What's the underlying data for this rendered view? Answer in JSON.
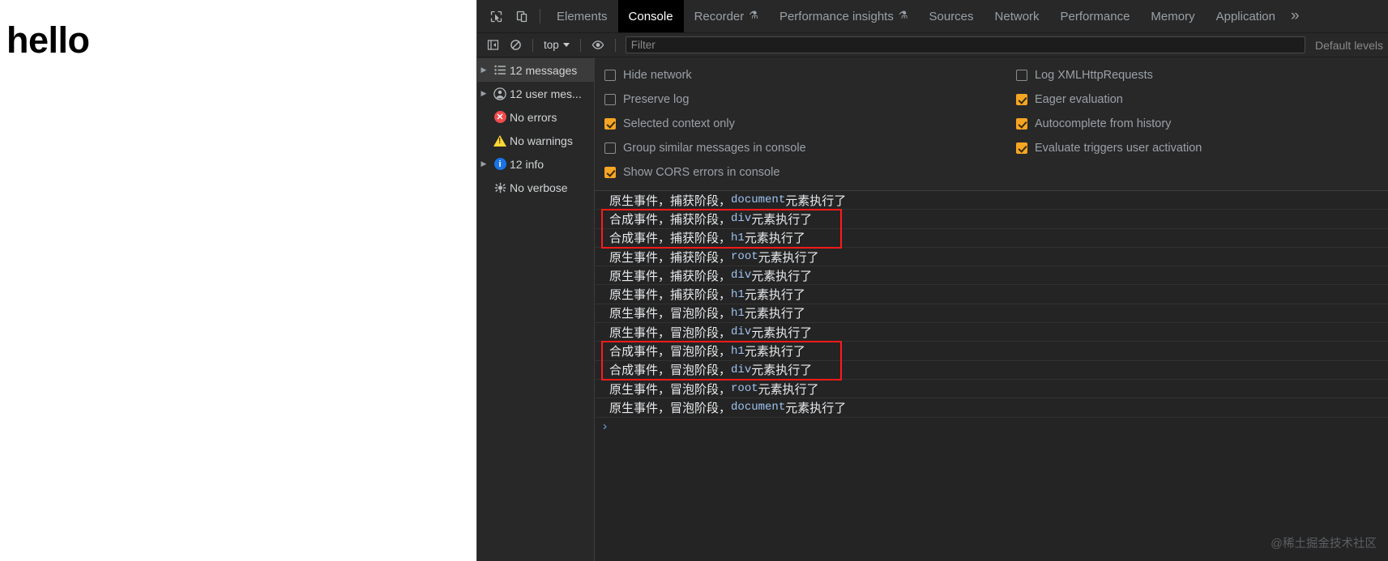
{
  "page": {
    "heading": "hello"
  },
  "devtools": {
    "toolbar_icons": [
      {
        "name": "inspect-element-icon",
        "glyph": "inspect"
      },
      {
        "name": "device-toolbar-icon",
        "glyph": "device"
      }
    ],
    "tabs": [
      {
        "label": "Elements",
        "active": false,
        "flask": false
      },
      {
        "label": "Console",
        "active": true,
        "flask": false
      },
      {
        "label": "Recorder",
        "active": false,
        "flask": true
      },
      {
        "label": "Performance insights",
        "active": false,
        "flask": true
      },
      {
        "label": "Sources",
        "active": false,
        "flask": false
      },
      {
        "label": "Network",
        "active": false,
        "flask": false
      },
      {
        "label": "Performance",
        "active": false,
        "flask": false
      },
      {
        "label": "Memory",
        "active": false,
        "flask": false
      },
      {
        "label": "Application",
        "active": false,
        "flask": false
      }
    ],
    "more_tabs_label": "»",
    "flask_glyph": "⚗",
    "filterbar": {
      "sidebar_toggle_icon": "show-console-sidebar-icon",
      "clear_console_icon": "clear-console-icon",
      "context_label": "top",
      "live_expression_icon": "create-live-expression-icon",
      "filter_placeholder": "Filter",
      "filter_value": "",
      "level_label": "Default levels"
    },
    "sidebar": [
      {
        "label": "12 messages",
        "icon": "list-icon",
        "disclosure": true,
        "selected": true
      },
      {
        "label": "12 user mes...",
        "icon": "user-icon",
        "disclosure": true,
        "selected": false
      },
      {
        "label": "No errors",
        "icon": "error-icon",
        "disclosure": false,
        "selected": false
      },
      {
        "label": "No warnings",
        "icon": "warning-icon",
        "disclosure": false,
        "selected": false
      },
      {
        "label": "12 info",
        "icon": "info-icon",
        "disclosure": true,
        "selected": false
      },
      {
        "label": "No verbose",
        "icon": "verbose-icon",
        "disclosure": false,
        "selected": false
      }
    ],
    "settings_left": [
      {
        "label": "Hide network",
        "checked": false
      },
      {
        "label": "Preserve log",
        "checked": false
      },
      {
        "label": "Selected context only",
        "checked": true
      },
      {
        "label": "Group similar messages in console",
        "checked": false
      },
      {
        "label": "Show CORS errors in console",
        "checked": true
      }
    ],
    "settings_right": [
      {
        "label": "Log XMLHttpRequests",
        "checked": false
      },
      {
        "label": "Eager evaluation",
        "checked": true
      },
      {
        "label": "Autocomplete from history",
        "checked": true
      },
      {
        "label": "Evaluate triggers user activation",
        "checked": true
      }
    ],
    "log_messages": [
      {
        "prefix": "原生事件，捕获阶段，",
        "code": "document",
        "suffix": "元素执行了"
      },
      {
        "prefix": "合成事件，捕获阶段，",
        "code": "div",
        "suffix": "元素执行了"
      },
      {
        "prefix": "合成事件，捕获阶段，",
        "code": "h1",
        "suffix": "元素执行了"
      },
      {
        "prefix": "原生事件，捕获阶段，",
        "code": "root",
        "suffix": "元素执行了"
      },
      {
        "prefix": "原生事件，捕获阶段，",
        "code": "div",
        "suffix": "元素执行了"
      },
      {
        "prefix": "原生事件，捕获阶段，",
        "code": "h1",
        "suffix": "元素执行了"
      },
      {
        "prefix": "原生事件，冒泡阶段，",
        "code": "h1",
        "suffix": "元素执行了"
      },
      {
        "prefix": "原生事件，冒泡阶段，",
        "code": "div",
        "suffix": "元素执行了"
      },
      {
        "prefix": "合成事件，冒泡阶段，",
        "code": "h1",
        "suffix": "元素执行了"
      },
      {
        "prefix": "合成事件，冒泡阶段，",
        "code": "div",
        "suffix": "元素执行了"
      },
      {
        "prefix": "原生事件，冒泡阶段，",
        "code": "root",
        "suffix": "元素执行了"
      },
      {
        "prefix": "原生事件，冒泡阶段，",
        "code": "document",
        "suffix": "元素执行了"
      }
    ],
    "prompt_glyph": "›",
    "annotations": [
      {
        "name": "capture-phase-synthetic-highlight",
        "rows": [
          1,
          2
        ]
      },
      {
        "name": "bubble-phase-synthetic-highlight",
        "rows": [
          8,
          9
        ]
      }
    ],
    "watermark": "@稀土掘金技术社区"
  },
  "colors": {
    "accent_checkbox": "#f5a623",
    "annotation_red": "#ff1a1a",
    "error_red": "#f04b4b",
    "warning_yellow": "#fdd633",
    "info_blue": "#1a73e8",
    "code_blue": "#9fc3f0",
    "panel_bg": "#242424",
    "toolbar_bg": "#282828"
  }
}
